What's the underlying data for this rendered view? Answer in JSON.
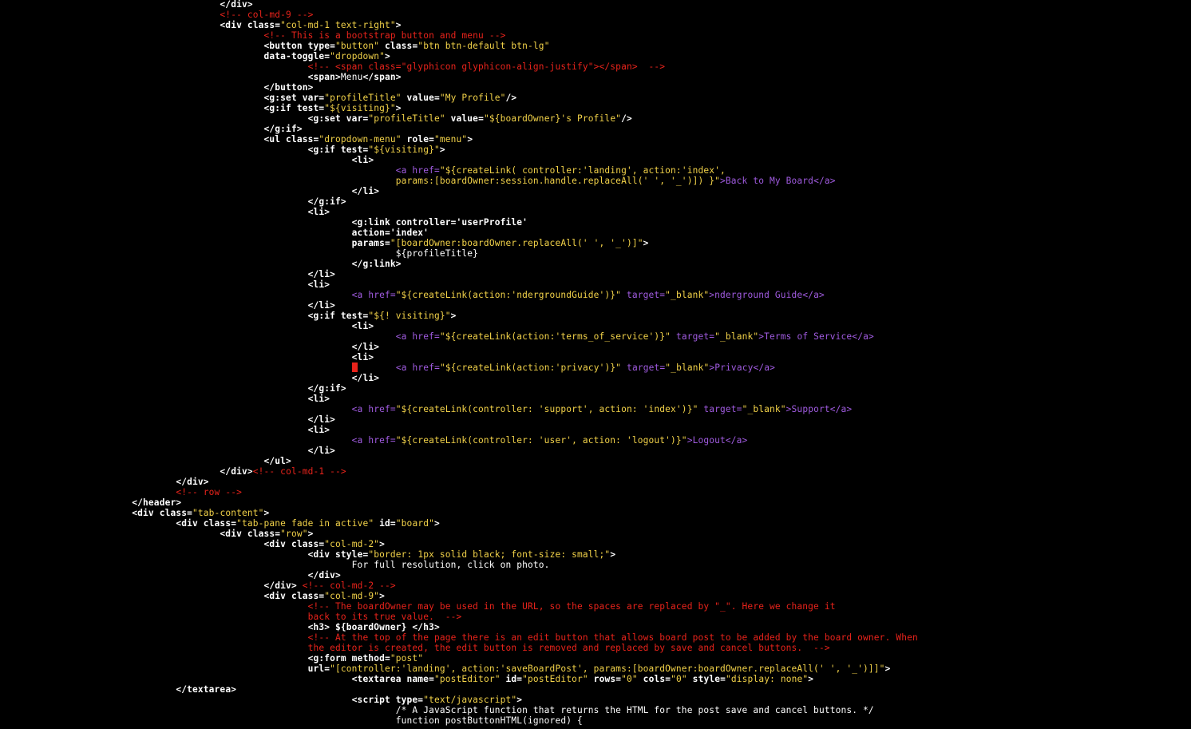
{
  "theme": {
    "background": "#000000",
    "tag_color": "#ffffff",
    "string_color": "#f2d249",
    "comment_color": "#e8231b",
    "link_color": "#a05be0",
    "cursor_color": "#e8231b"
  },
  "editor": {
    "cursor_line": 35,
    "lines": [
      {
        "indent": 5,
        "segments": [
          {
            "k": "t",
            "v": "</div>"
          }
        ]
      },
      {
        "indent": 5,
        "segments": [
          {
            "k": "c",
            "v": "<!-- col-md-9 -->"
          }
        ]
      },
      {
        "indent": 5,
        "segments": [
          {
            "k": "t",
            "v": "<div class="
          },
          {
            "k": "s",
            "v": "\"col-md-1 text-right\""
          },
          {
            "k": "t",
            "v": ">"
          }
        ]
      },
      {
        "indent": 6,
        "segments": [
          {
            "k": "c",
            "v": "<!-- This is a bootstrap button and menu -->"
          }
        ]
      },
      {
        "indent": 6,
        "segments": [
          {
            "k": "t",
            "v": "<button type="
          },
          {
            "k": "s",
            "v": "\"button\""
          },
          {
            "k": "t",
            "v": " class="
          },
          {
            "k": "s",
            "v": "\"btn btn-default btn-lg\""
          }
        ]
      },
      {
        "indent": 6,
        "segments": [
          {
            "k": "t",
            "v": "data-toggle="
          },
          {
            "k": "s",
            "v": "\"dropdown\""
          },
          {
            "k": "t",
            "v": ">"
          }
        ]
      },
      {
        "indent": 7,
        "segments": [
          {
            "k": "c",
            "v": "<!-- <span class=\"glyphicon glyphicon-align-justify\"></span>  -->"
          }
        ]
      },
      {
        "indent": 7,
        "segments": [
          {
            "k": "t",
            "v": "<span>"
          },
          {
            "k": "p",
            "v": "Menu"
          },
          {
            "k": "t",
            "v": "</span>"
          }
        ]
      },
      {
        "indent": 6,
        "segments": [
          {
            "k": "t",
            "v": "</button>"
          }
        ]
      },
      {
        "indent": 6,
        "segments": [
          {
            "k": "t",
            "v": "<g:set var="
          },
          {
            "k": "s",
            "v": "\"profileTitle\""
          },
          {
            "k": "t",
            "v": " value="
          },
          {
            "k": "s",
            "v": "\"My Profile\""
          },
          {
            "k": "t",
            "v": "/>"
          }
        ]
      },
      {
        "indent": 6,
        "segments": [
          {
            "k": "t",
            "v": "<g:if test="
          },
          {
            "k": "s",
            "v": "\"${visiting}\""
          },
          {
            "k": "t",
            "v": ">"
          }
        ]
      },
      {
        "indent": 7,
        "segments": [
          {
            "k": "t",
            "v": "<g:set var="
          },
          {
            "k": "s",
            "v": "\"profileTitle\""
          },
          {
            "k": "t",
            "v": " value="
          },
          {
            "k": "s",
            "v": "\"${boardOwner}'s Profile\""
          },
          {
            "k": "t",
            "v": "/>"
          }
        ]
      },
      {
        "indent": 6,
        "segments": [
          {
            "k": "t",
            "v": "</g:if>"
          }
        ]
      },
      {
        "indent": 6,
        "segments": [
          {
            "k": "t",
            "v": "<ul class="
          },
          {
            "k": "s",
            "v": "\"dropdown-menu\""
          },
          {
            "k": "t",
            "v": " role="
          },
          {
            "k": "s",
            "v": "\"menu\""
          },
          {
            "k": "t",
            "v": ">"
          }
        ]
      },
      {
        "indent": 7,
        "segments": [
          {
            "k": "t",
            "v": "<g:if test="
          },
          {
            "k": "s",
            "v": "\"${visiting}\""
          },
          {
            "k": "t",
            "v": ">"
          }
        ]
      },
      {
        "indent": 8,
        "segments": [
          {
            "k": "t",
            "v": "<li>"
          }
        ]
      },
      {
        "indent": 9,
        "segments": [
          {
            "k": "l",
            "v": "<a href="
          },
          {
            "k": "s",
            "v": "\"${createLink( controller:'landing', action:'index',"
          }
        ]
      },
      {
        "indent": 9,
        "segments": [
          {
            "k": "s",
            "v": "params:[boardOwner:session.handle.replaceAll(' ', '_')]) }\""
          },
          {
            "k": "l",
            "v": ">Back to My Board</a>"
          }
        ]
      },
      {
        "indent": 8,
        "segments": [
          {
            "k": "t",
            "v": "</li>"
          }
        ]
      },
      {
        "indent": 7,
        "segments": [
          {
            "k": "t",
            "v": "</g:if>"
          }
        ]
      },
      {
        "indent": 7,
        "segments": [
          {
            "k": "t",
            "v": "<li>"
          }
        ]
      },
      {
        "indent": 8,
        "segments": [
          {
            "k": "t",
            "v": "<g:link controller='userProfile'"
          }
        ]
      },
      {
        "indent": 8,
        "segments": [
          {
            "k": "t",
            "v": "action='index'"
          }
        ]
      },
      {
        "indent": 8,
        "segments": [
          {
            "k": "t",
            "v": "params="
          },
          {
            "k": "s",
            "v": "\"[boardOwner:boardOwner.replaceAll(' ', '_')]\""
          },
          {
            "k": "t",
            "v": ">"
          }
        ]
      },
      {
        "indent": 9,
        "segments": [
          {
            "k": "p",
            "v": "${profileTitle}"
          }
        ]
      },
      {
        "indent": 8,
        "segments": [
          {
            "k": "t",
            "v": "</g:link>"
          }
        ]
      },
      {
        "indent": 7,
        "segments": [
          {
            "k": "t",
            "v": "</li>"
          }
        ]
      },
      {
        "indent": 7,
        "segments": [
          {
            "k": "t",
            "v": "<li>"
          }
        ]
      },
      {
        "indent": 8,
        "segments": [
          {
            "k": "l",
            "v": "<a href="
          },
          {
            "k": "s",
            "v": "\"${createLink(action:'ndergroundGuide')}\""
          },
          {
            "k": "l",
            "v": " target="
          },
          {
            "k": "s",
            "v": "\"_blank\""
          },
          {
            "k": "l",
            "v": ">nderground Guide</a>"
          }
        ]
      },
      {
        "indent": 7,
        "segments": [
          {
            "k": "t",
            "v": "</li>"
          }
        ]
      },
      {
        "indent": 7,
        "segments": [
          {
            "k": "t",
            "v": "<g:if test="
          },
          {
            "k": "s",
            "v": "\"${! visiting}\""
          },
          {
            "k": "t",
            "v": ">"
          }
        ]
      },
      {
        "indent": 8,
        "segments": [
          {
            "k": "t",
            "v": "<li>"
          }
        ]
      },
      {
        "indent": 9,
        "segments": [
          {
            "k": "l",
            "v": "<a href="
          },
          {
            "k": "s",
            "v": "\"${createLink(action:'terms_of_service')}\""
          },
          {
            "k": "l",
            "v": " target="
          },
          {
            "k": "s",
            "v": "\"_blank\""
          },
          {
            "k": "l",
            "v": ">Terms of Service</a>"
          }
        ]
      },
      {
        "indent": 8,
        "segments": [
          {
            "k": "t",
            "v": "</li>"
          }
        ]
      },
      {
        "indent": 8,
        "segments": [
          {
            "k": "t",
            "v": "<li>"
          }
        ]
      },
      {
        "indent": 8,
        "segments": [
          {
            "k": "p",
            "v": "       "
          },
          {
            "k": "l",
            "v": "<a href="
          },
          {
            "k": "s",
            "v": "\"${createLink(action:'privacy')}\""
          },
          {
            "k": "l",
            "v": " target="
          },
          {
            "k": "s",
            "v": "\"_blank\""
          },
          {
            "k": "l",
            "v": ">Privacy</a>"
          }
        ]
      },
      {
        "indent": 8,
        "segments": [
          {
            "k": "t",
            "v": "</li>"
          }
        ]
      },
      {
        "indent": 7,
        "segments": [
          {
            "k": "t",
            "v": "</g:if>"
          }
        ]
      },
      {
        "indent": 7,
        "segments": [
          {
            "k": "t",
            "v": "<li>"
          }
        ]
      },
      {
        "indent": 8,
        "segments": [
          {
            "k": "l",
            "v": "<a href="
          },
          {
            "k": "s",
            "v": "\"${createLink(controller: 'support', action: 'index')}\""
          },
          {
            "k": "l",
            "v": " target="
          },
          {
            "k": "s",
            "v": "\"_blank\""
          },
          {
            "k": "l",
            "v": ">Support</a>"
          }
        ]
      },
      {
        "indent": 7,
        "segments": [
          {
            "k": "t",
            "v": "</li>"
          }
        ]
      },
      {
        "indent": 7,
        "segments": [
          {
            "k": "t",
            "v": "<li>"
          }
        ]
      },
      {
        "indent": 8,
        "segments": [
          {
            "k": "l",
            "v": "<a href="
          },
          {
            "k": "s",
            "v": "\"${createLink(controller: 'user', action: 'logout')}\""
          },
          {
            "k": "l",
            "v": ">Logout</a>"
          }
        ]
      },
      {
        "indent": 7,
        "segments": [
          {
            "k": "t",
            "v": "</li>"
          }
        ]
      },
      {
        "indent": 6,
        "segments": [
          {
            "k": "t",
            "v": "</ul>"
          }
        ]
      },
      {
        "indent": 5,
        "segments": [
          {
            "k": "t",
            "v": "</div>"
          },
          {
            "k": "c",
            "v": "<!-- col-md-1 -->"
          }
        ]
      },
      {
        "indent": 4,
        "segments": [
          {
            "k": "t",
            "v": "</div>"
          }
        ]
      },
      {
        "indent": 4,
        "segments": [
          {
            "k": "c",
            "v": "<!-- row -->"
          }
        ]
      },
      {
        "indent": 3,
        "segments": [
          {
            "k": "t",
            "v": "</header>"
          }
        ]
      },
      {
        "indent": 3,
        "segments": [
          {
            "k": "t",
            "v": "<div class="
          },
          {
            "k": "s",
            "v": "\"tab-content\""
          },
          {
            "k": "t",
            "v": ">"
          }
        ]
      },
      {
        "indent": 4,
        "segments": [
          {
            "k": "t",
            "v": "<div class="
          },
          {
            "k": "s",
            "v": "\"tab-pane fade in active\""
          },
          {
            "k": "t",
            "v": " id="
          },
          {
            "k": "s",
            "v": "\"board\""
          },
          {
            "k": "t",
            "v": ">"
          }
        ]
      },
      {
        "indent": 5,
        "segments": [
          {
            "k": "t",
            "v": "<div class="
          },
          {
            "k": "s",
            "v": "\"row\""
          },
          {
            "k": "t",
            "v": ">"
          }
        ]
      },
      {
        "indent": 6,
        "segments": [
          {
            "k": "t",
            "v": "<div class="
          },
          {
            "k": "s",
            "v": "\"col-md-2\""
          },
          {
            "k": "t",
            "v": ">"
          }
        ]
      },
      {
        "indent": 7,
        "segments": [
          {
            "k": "t",
            "v": "<div style="
          },
          {
            "k": "s",
            "v": "\"border: 1px solid black; font-size: small;\""
          },
          {
            "k": "t",
            "v": ">"
          }
        ]
      },
      {
        "indent": 8,
        "segments": [
          {
            "k": "p",
            "v": "For full resolution, click on photo."
          }
        ]
      },
      {
        "indent": 7,
        "segments": [
          {
            "k": "t",
            "v": "</div>"
          }
        ]
      },
      {
        "indent": 6,
        "segments": [
          {
            "k": "t",
            "v": "</div> "
          },
          {
            "k": "c",
            "v": "<!-- col-md-2 -->"
          }
        ]
      },
      {
        "indent": 6,
        "segments": [
          {
            "k": "t",
            "v": "<div class="
          },
          {
            "k": "s",
            "v": "\"col-md-9\""
          },
          {
            "k": "t",
            "v": ">"
          }
        ]
      },
      {
        "indent": 7,
        "segments": [
          {
            "k": "c",
            "v": "<!-- The boardOwner may be used in the URL, so the spaces are replaced by \"_\". Here we change it"
          }
        ]
      },
      {
        "indent": 7,
        "segments": [
          {
            "k": "c",
            "v": "back to its true value.  -->"
          }
        ]
      },
      {
        "indent": 7,
        "segments": [
          {
            "k": "t",
            "v": "<h3> ${boardOwner} </h3>"
          }
        ]
      },
      {
        "indent": 7,
        "segments": [
          {
            "k": "c",
            "v": "<!-- At the top of the page there is an edit button that allows board post to be added by the board owner. When"
          }
        ]
      },
      {
        "indent": 7,
        "segments": [
          {
            "k": "c",
            "v": "the editor is created, the edit button is removed and replaced by save and cancel buttons.  -->"
          }
        ]
      },
      {
        "indent": 7,
        "segments": [
          {
            "k": "t",
            "v": "<g:form method="
          },
          {
            "k": "s",
            "v": "\"post\""
          }
        ]
      },
      {
        "indent": 7,
        "segments": [
          {
            "k": "t",
            "v": "url="
          },
          {
            "k": "s",
            "v": "\"[controller:'landing', action:'saveBoardPost', params:[boardOwner:boardOwner.replaceAll(' ', '_')]]\""
          },
          {
            "k": "t",
            "v": ">"
          }
        ]
      },
      {
        "indent": 8,
        "segments": [
          {
            "k": "t",
            "v": "<textarea name="
          },
          {
            "k": "s",
            "v": "\"postEditor\""
          },
          {
            "k": "t",
            "v": " id="
          },
          {
            "k": "s",
            "v": "\"postEditor\""
          },
          {
            "k": "t",
            "v": " rows="
          },
          {
            "k": "s",
            "v": "\"0\""
          },
          {
            "k": "t",
            "v": " cols="
          },
          {
            "k": "s",
            "v": "\"0\""
          },
          {
            "k": "t",
            "v": " style="
          },
          {
            "k": "s",
            "v": "\"display: none\""
          },
          {
            "k": "t",
            "v": ">"
          }
        ]
      },
      {
        "indent": 4,
        "segments": [
          {
            "k": "t",
            "v": "</textarea>"
          }
        ]
      },
      {
        "indent": 8,
        "segments": [
          {
            "k": "t",
            "v": "<script type="
          },
          {
            "k": "s",
            "v": "\"text/javascript\""
          },
          {
            "k": "t",
            "v": ">"
          }
        ]
      },
      {
        "indent": 9,
        "segments": [
          {
            "k": "p",
            "v": "/* A JavaScript function that returns the HTML for the post save and cancel buttons. */"
          }
        ]
      },
      {
        "indent": 9,
        "segments": [
          {
            "k": "p",
            "v": "function postButtonHTML(ignored) {"
          }
        ]
      }
    ]
  }
}
